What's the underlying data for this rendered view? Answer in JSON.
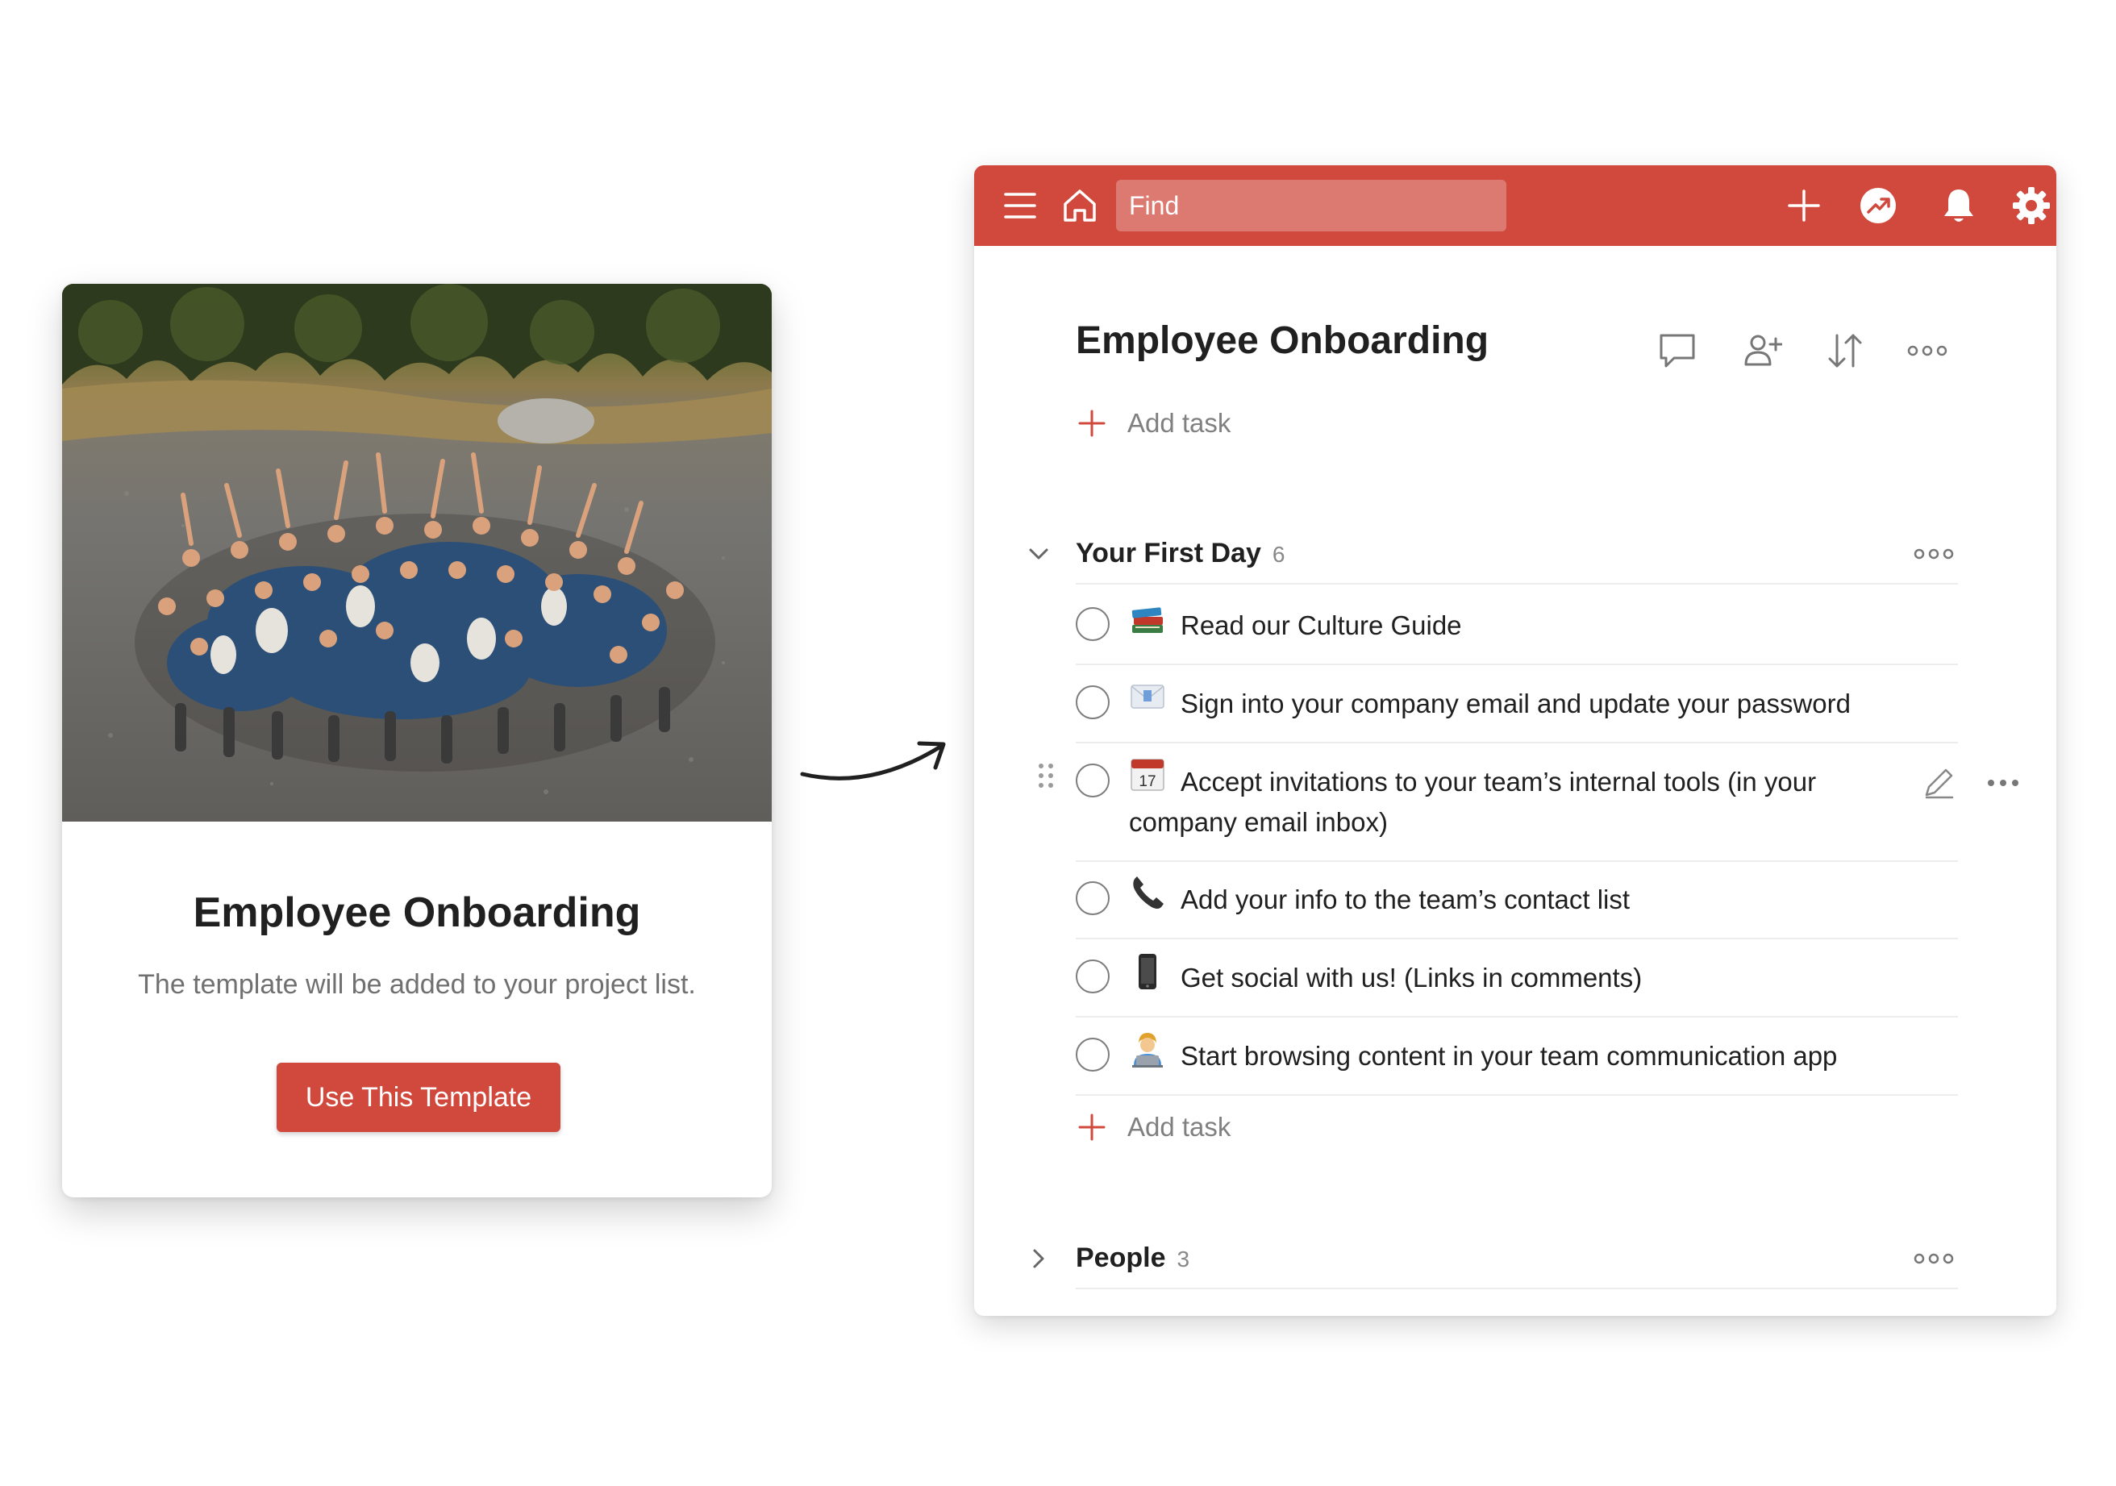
{
  "template_card": {
    "title": "Employee Onboarding",
    "subtitle": "The template will be added to your project list.",
    "button_label": "Use This Template"
  },
  "app": {
    "search": {
      "placeholder": "Find"
    },
    "project": {
      "title": "Employee Onboarding",
      "add_task_label": "Add task"
    },
    "sections": [
      {
        "name": "Your First Day",
        "count": "6",
        "expanded": true,
        "add_task_label": "Add task",
        "tasks": [
          {
            "icon": "books-emoji",
            "text": "Read our Culture Guide"
          },
          {
            "icon": "envelope-emoji",
            "text": "Sign into your company email and update your password"
          },
          {
            "icon": "calendar-emoji",
            "icon_text": "17",
            "text": "Accept invitations to your team’s internal tools (in your company email inbox)"
          },
          {
            "icon": "telephone-emoji",
            "text": "Add your info to the team’s contact list"
          },
          {
            "icon": "mobile-phone-emoji",
            "text": "Get social with us! (Links in comments)"
          },
          {
            "icon": "technologist-emoji",
            "text": "Start browsing content in your team communication app"
          }
        ]
      },
      {
        "name": "People",
        "count": "3",
        "expanded": false
      }
    ]
  },
  "colors": {
    "brand": "#d1493d",
    "search_bg": "#dc7a71",
    "divider": "#ececec"
  }
}
